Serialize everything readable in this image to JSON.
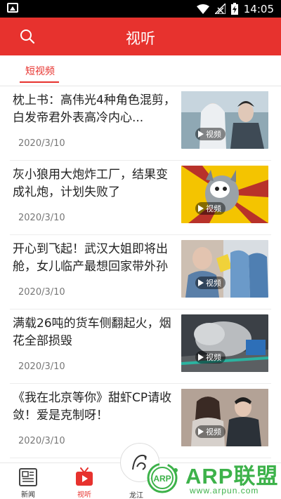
{
  "status_bar": {
    "time": "14:05"
  },
  "header": {
    "title": "视听"
  },
  "tabs": [
    {
      "label": "短视频"
    }
  ],
  "video_badge_label": "视频",
  "news": [
    {
      "headline": "枕上书：高伟光4种角色混剪，白发帝君外表高冷内心...",
      "date": "2020/3/10"
    },
    {
      "headline": "灰小狼用大炮炸工厂，结果变成礼炮，计划失败了",
      "date": "2020/3/10"
    },
    {
      "headline": "开心到飞起！武汉大姐即将出舱，女儿临产最想回家带外孙",
      "date": "2020/3/10"
    },
    {
      "headline": "满载26吨的货车侧翻起火，烟花全部损毁",
      "date": "2020/3/10"
    },
    {
      "headline": "《我在北京等你》甜虾CP请收敛！爱是克制呀！",
      "date": "2020/3/10"
    }
  ],
  "bottom_nav": [
    {
      "label": "新闻"
    },
    {
      "label": "视听"
    },
    {
      "label": "龙江"
    }
  ],
  "watermark": {
    "title": "ARP联盟",
    "logo_text": "ARP",
    "url": "www.arpun.com"
  },
  "colors": {
    "accent": "#e7322e",
    "watermark_green": "#3db24a"
  }
}
